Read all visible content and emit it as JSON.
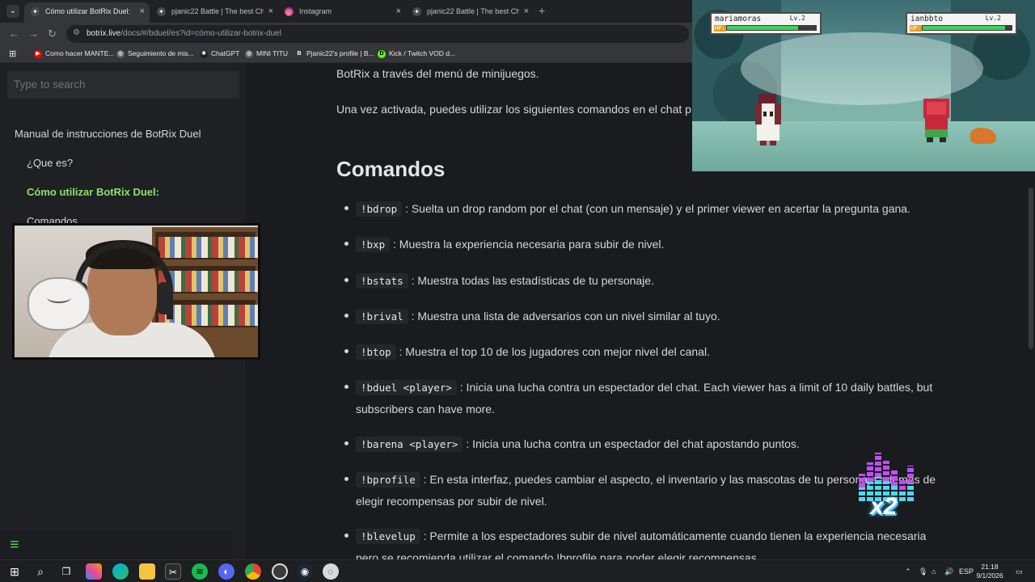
{
  "browser": {
    "tabs": [
      {
        "title": "Cómo utilizar BotRix Duel:",
        "active": true,
        "icon": "botrix-icon"
      },
      {
        "title": "pjanic22 Battle | The best ChatBot",
        "active": false,
        "icon": "botrix-icon"
      },
      {
        "title": "Instagram",
        "active": false,
        "icon": "instagram-icon"
      },
      {
        "title": "pjanic22 Battle | The best ChatBot",
        "active": false,
        "icon": "botrix-icon"
      }
    ],
    "new_tab": "+",
    "close_glyph": "×",
    "url_host": "botrix.live",
    "url_path": "/docs/#/bduel/es?id=cómo-utilizar-botrix-duel",
    "bookmarks": [
      {
        "label": "Como hacer MANTE...",
        "icon": "youtube-icon",
        "color": "#ff0000"
      },
      {
        "label": "Seguimiento de mis...",
        "icon": "globe-icon",
        "color": "#8ab4f8"
      },
      {
        "label": "ChatGPT",
        "icon": "chatgpt-icon",
        "color": "#202124"
      },
      {
        "label": "MINI TITU",
        "icon": "globe-icon",
        "color": "#8ab4f8"
      },
      {
        "label": "Pjanic22's profile | B...",
        "icon": "b-icon",
        "color": "#35363a"
      },
      {
        "label": "Kick / Twitch VOD d...",
        "icon": "kick-icon",
        "color": "#53fc18"
      }
    ]
  },
  "sidebar": {
    "search_placeholder": "Type to search",
    "items": [
      {
        "label": "Manual de instrucciones de BotRix Duel",
        "level": 0,
        "active": false
      },
      {
        "label": "¿Que es?",
        "level": 1,
        "active": false
      },
      {
        "label": "Cómo utilizar BotRix Duel:",
        "level": 1,
        "active": true
      },
      {
        "label": "Comandos",
        "level": 1,
        "active": false
      }
    ],
    "menu_icon": "≡"
  },
  "content": {
    "intro_1": "BotRix a través del menú de minijuegos.",
    "intro_2": "Una vez activada, puedes utilizar los siguientes comandos en el chat p",
    "heading": "Comandos",
    "commands": [
      {
        "cmd": "!bdrop",
        "desc": ": Suelta un drop random por el chat (con un mensaje) y el primer viewer en acertar la pregunta gana.",
        "cont": ""
      },
      {
        "cmd": "!bxp",
        "desc": ": Muestra la experiencia necesaria para subir de nivel.",
        "cont": ""
      },
      {
        "cmd": "!bstats",
        "desc": ": Muestra todas las estadísticas de tu personaje.",
        "cont": ""
      },
      {
        "cmd": "!brival",
        "desc": ": Muestra una lista de adversarios con un nivel similar al tuyo.",
        "cont": ""
      },
      {
        "cmd": "!btop",
        "desc": ": Muestra el top 10 de los jugadores con mejor nivel del canal.",
        "cont": ""
      },
      {
        "cmd": "!bduel <player>",
        "desc": ": Inicia una lucha contra un espectador del chat. Each viewer has a limit of 10 daily battles, but",
        "cont": "subscribers can have more."
      },
      {
        "cmd": "!barena <player>",
        "desc": ": Inicia una lucha contra un espectador del chat apostando puntos.",
        "cont": ""
      },
      {
        "cmd": "!bprofile",
        "desc": ": En esta interfaz, puedes cambiar el aspecto, el inventario y las mascotas de tu personaje además de",
        "cont": "elegir recompensas por subir de nivel."
      },
      {
        "cmd": "!blevelup",
        "desc": ": Permite a los espectadores subir de nivel automáticamente cuando tienen la experiencia necesaria",
        "cont": "pero se recomienda utilizar el comando !bprofile para poder elegir recompensas."
      }
    ]
  },
  "game": {
    "player1": {
      "name": "mariamoras",
      "level": "Lv.2",
      "hp_label": "HP:",
      "hp": 0.8
    },
    "player2": {
      "name": "ianbbto",
      "level": "Lv.2",
      "hp_label": "HP:",
      "hp": 0.93
    }
  },
  "overlay": {
    "multiplier": "x2",
    "eq_levels": [
      0.55,
      0.75,
      0.95,
      0.8,
      0.6,
      0.45,
      0.7
    ],
    "eq_colors": {
      "top": "#c24dff",
      "bottom": "#4bd8ff"
    }
  },
  "taskbar": {
    "icons": [
      "windows-start-icon",
      "search-icon",
      "task-view-icon",
      "copilot-icon",
      "edge-icon",
      "file-explorer-icon",
      "capcut-icon",
      "spotify-icon",
      "discord-icon",
      "chrome-icon",
      "obs-icon",
      "steam-icon",
      "app-icon"
    ],
    "lang": "ESP",
    "time": "21:18",
    "date": "9/1/2026"
  }
}
